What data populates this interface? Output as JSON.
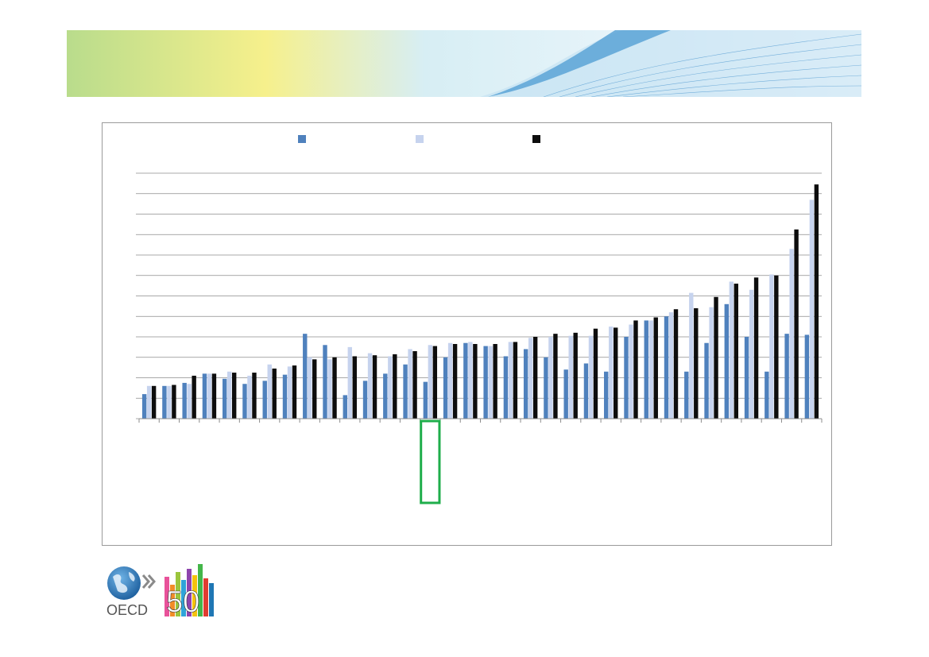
{
  "logo": {
    "text": "OECD",
    "number": "50"
  },
  "colors": {
    "series_1": "#4f81bd",
    "series_2": "#c6d3ee",
    "series_3": "#0d0d0d",
    "highlight": "#1fae4b",
    "gridline": "#8c8c8c"
  },
  "chart_data": {
    "type": "bar",
    "title": "",
    "xlabel": "",
    "ylabel": "",
    "ylim": [
      0,
      12
    ],
    "grid": true,
    "legend": "top-center",
    "categories": [
      "",
      "",
      "",
      "",
      "",
      "",
      "",
      "",
      "",
      "",
      "",
      "",
      "",
      "",
      "",
      "",
      "",
      "",
      "",
      "",
      "",
      "",
      "",
      "",
      "",
      "",
      "",
      "",
      "",
      "",
      "",
      "",
      "",
      ""
    ],
    "highlighted_category_index": 14,
    "series": [
      {
        "name": "",
        "values": [
          1.2,
          1.6,
          1.75,
          2.2,
          1.95,
          1.7,
          1.85,
          2.15,
          4.15,
          3.6,
          1.15,
          1.85,
          2.2,
          2.65,
          1.8,
          3.0,
          3.7,
          3.55,
          3.05,
          3.4,
          3.0,
          2.4,
          2.7,
          2.3,
          4.0,
          4.8,
          5.0,
          2.3,
          3.7,
          5.6,
          4.0,
          2.3,
          4.15,
          4.1
        ]
      },
      {
        "name": "",
        "values": [
          1.6,
          1.6,
          1.7,
          2.2,
          2.3,
          2.1,
          2.65,
          2.55,
          3.0,
          2.9,
          3.5,
          3.2,
          3.05,
          3.4,
          3.6,
          3.7,
          3.75,
          3.55,
          3.75,
          3.95,
          4.0,
          4.05,
          4.05,
          4.5,
          4.6,
          4.8,
          5.2,
          6.15,
          5.45,
          6.7,
          6.3,
          7.05,
          8.3,
          10.7
        ]
      },
      {
        "name": "",
        "values": [
          1.6,
          1.65,
          2.1,
          2.2,
          2.25,
          2.25,
          2.45,
          2.6,
          2.9,
          3.0,
          3.05,
          3.1,
          3.15,
          3.3,
          3.55,
          3.65,
          3.65,
          3.65,
          3.75,
          4.0,
          4.15,
          4.2,
          4.4,
          4.45,
          4.8,
          4.95,
          5.35,
          5.4,
          5.95,
          6.6,
          6.9,
          7.0,
          9.25,
          11.45
        ]
      }
    ]
  }
}
